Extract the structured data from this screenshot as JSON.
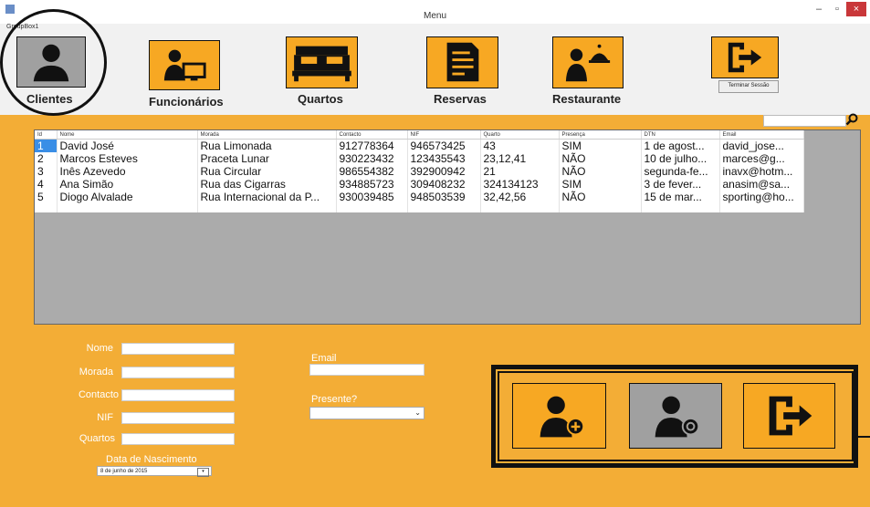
{
  "window": {
    "title": "Menu",
    "minimize": "–",
    "maximize": "▫",
    "close": "×"
  },
  "groupbox": {
    "label": "GroupBox1"
  },
  "nav": [
    {
      "label": "Clientes",
      "icon": "person-icon"
    },
    {
      "label": "Funcionários",
      "icon": "employee-computer-icon"
    },
    {
      "label": "Quartos",
      "icon": "bed-icon"
    },
    {
      "label": "Reservas",
      "icon": "document-icon"
    },
    {
      "label": "Restaurante",
      "icon": "waiter-cloche-icon"
    }
  ],
  "logout": {
    "label": "Terminar Sessão",
    "icon": "exit-door-icon"
  },
  "search": {
    "value": "",
    "icon": "magnifier-icon"
  },
  "table": {
    "columns": [
      "Id",
      "Nome",
      "Morada",
      "Contacto",
      "NIF",
      "Quarto",
      "Presença",
      "DTN",
      "Email"
    ],
    "rows": [
      [
        "1",
        "David José",
        "Rua Limonada",
        "912778364",
        "946573425",
        "43",
        "SIM",
        "1 de agost...",
        "david_jose..."
      ],
      [
        "2",
        "Marcos Esteves",
        "Praceta Lunar",
        "930223432",
        "123435543",
        "23,12,41",
        "NÃO",
        "10 de julho...",
        "marces@g..."
      ],
      [
        "3",
        "Inês Azevedo",
        "Rua Circular",
        "986554382",
        "392900942",
        "21",
        "NÃO",
        "segunda-fe...",
        "inavx@hotm..."
      ],
      [
        "4",
        "Ana Simão",
        "Rua das Cigarras",
        "934885723",
        "309408232",
        "324134123",
        "SIM",
        "3 de fever...",
        "anasim@sa..."
      ],
      [
        "5",
        "Diogo Alvalade",
        "Rua Internacional da P...",
        "930039485",
        "948503539",
        "32,42,56",
        "NÃO",
        "15 de mar...",
        "sporting@ho..."
      ]
    ]
  },
  "form": {
    "nome_label": "Nome",
    "morada_label": "Morada",
    "contacto_label": "Contacto",
    "nif_label": "NIF",
    "quartos_label": "Quartos",
    "email_label": "Email",
    "presente_label": "Presente?",
    "dob_label": "Data de Nascimento",
    "dob_value": "8 de  junho  de 2015"
  },
  "actions": [
    {
      "name": "add-client-button",
      "icon": "add-user-icon"
    },
    {
      "name": "view-client-button",
      "icon": "search-user-icon"
    },
    {
      "name": "exit-button",
      "icon": "exit-door-icon"
    }
  ],
  "colors": {
    "accent": "#f7a823",
    "background": "#f3ad36",
    "selected": "#3a8ee6",
    "active_tile": "#a0a0a0"
  }
}
